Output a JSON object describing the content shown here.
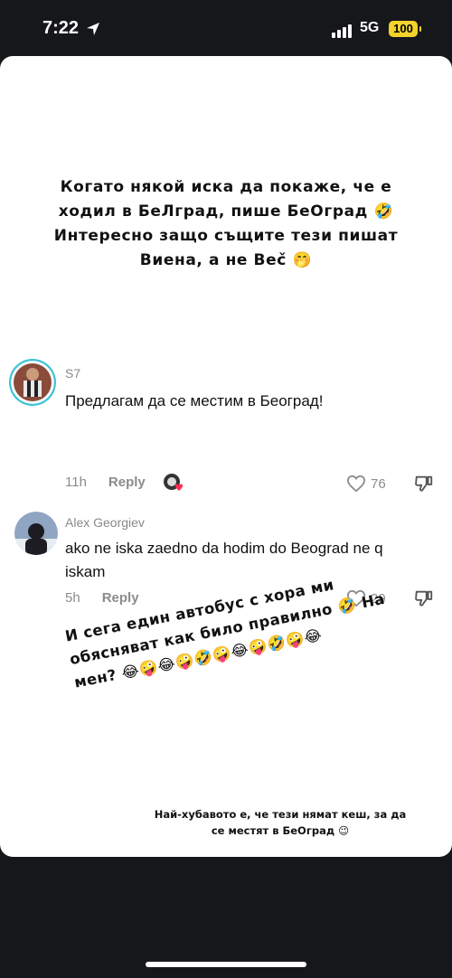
{
  "status_bar": {
    "time": "7:22",
    "network": "5G",
    "battery": "100"
  },
  "post": {
    "headline": "Когато някой иска да покаже, че е ходил в БеЛград, пише БеОград 🤣 Интересно защо същите тези пишат Виена, а не Веč 🤭",
    "bottom_text": "И сега един автобус с хора ми обясняват как било правилно 🤣 На мен? 😂🤪😂🤪🤣🤪😂🤪🤣🤪😂",
    "footer_text": "Най-хубавото е, че тези нямат кеш, за да се местят в БеОград 😉"
  },
  "comments": [
    {
      "username": "S7",
      "text": "Предлагам да се местим в Београд!",
      "time": "11h",
      "reply_label": "Reply",
      "likes": "76"
    },
    {
      "username": "Alex Georgiev",
      "text": "ako ne iska zaedno da hodim do Beograd ne q iskam",
      "time": "5h",
      "reply_label": "Reply",
      "likes": "29"
    }
  ],
  "colors": {
    "background": "#16171b",
    "battery": "#f2d22b",
    "card": "#ffffff"
  }
}
